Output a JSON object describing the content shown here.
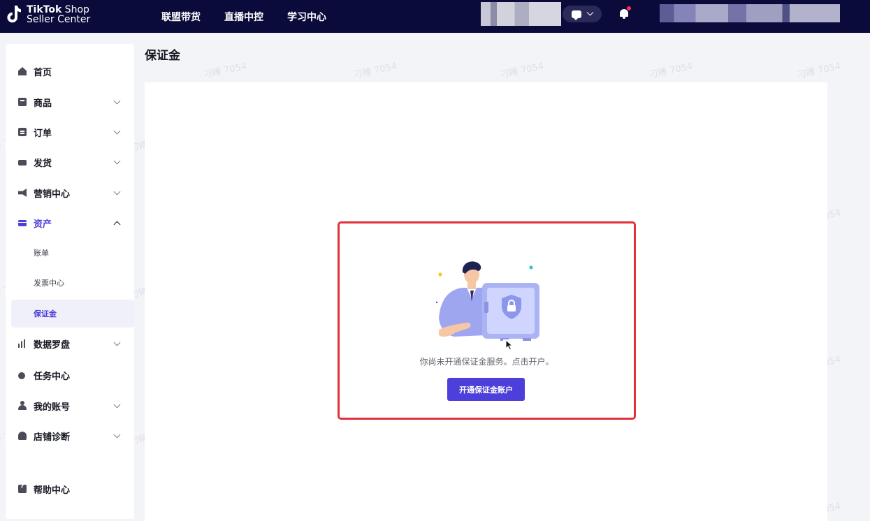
{
  "header": {
    "logo": {
      "brand": "TikTok",
      "product": "Shop",
      "sub": "Seller Center"
    },
    "nav": [
      "联盟带货",
      "直播中控",
      "学习中心"
    ]
  },
  "sidebar": {
    "items": [
      {
        "label": "首页",
        "icon": "home-icon"
      },
      {
        "label": "商品",
        "icon": "product-icon"
      },
      {
        "label": "订单",
        "icon": "order-icon"
      },
      {
        "label": "发货",
        "icon": "shipping-icon"
      },
      {
        "label": "营销中心",
        "icon": "megaphone-icon"
      },
      {
        "label": "资产",
        "icon": "wallet-icon"
      },
      {
        "label": "数据罗盘",
        "icon": "chart-icon"
      },
      {
        "label": "任务中心",
        "icon": "medal-icon"
      },
      {
        "label": "我的账号",
        "icon": "user-icon"
      },
      {
        "label": "店铺诊断",
        "icon": "shop-icon"
      },
      {
        "label": "帮助中心",
        "icon": "help-icon"
      }
    ],
    "sub_items": [
      {
        "label": "账单"
      },
      {
        "label": "发票中心"
      },
      {
        "label": "保证金"
      }
    ]
  },
  "main": {
    "title": "保证金",
    "empty_text": "你尚未开通保证金服务。点击开户。",
    "open_button": "开通保证金账户"
  },
  "watermark": "刁睡 7054",
  "colors": {
    "topbar": "#0b0b3b",
    "accent": "#4d3fd9",
    "highlight": "#e0323c"
  }
}
